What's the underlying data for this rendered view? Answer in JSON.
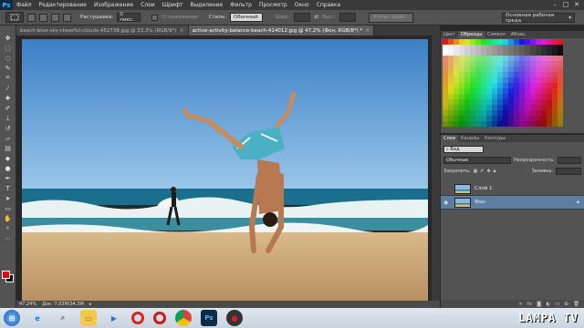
{
  "app": {
    "logo": "Ps",
    "menu": [
      "Файл",
      "Редактирование",
      "Изображение",
      "Слои",
      "Шрифт",
      "Выделение",
      "Фильтр",
      "Просмотр",
      "Окно",
      "Справка"
    ],
    "window_controls": [
      "–",
      "□",
      "✕"
    ]
  },
  "options": {
    "feather_label": "Растушевка:",
    "feather_value": "0 пикс.",
    "antialias_label": "Сглаживание",
    "style_label": "Стиль:",
    "style_value": "Обычный",
    "width_label": "Шир.:",
    "height_label": "Выс.:",
    "refine_edge": "Уточн. край...",
    "workspace": "Основная рабочая среда"
  },
  "documents": [
    {
      "title": "beach-blue-sky-cheerful-clouds-452738.jpg @ 33,3% (RGB/8*)"
    },
    {
      "title": "active-activity-balance-beach-414012.jpg @ 47,2% (Фон, RGB/8*) *"
    }
  ],
  "status": {
    "zoom": "47,24%",
    "doc_size": "Док: 7,03M/34,3M"
  },
  "swatch_panel": {
    "tabs": [
      "Цвет",
      "Образцы",
      "Символ",
      "Абзац"
    ],
    "active_tab": 1
  },
  "layers_panel": {
    "tabs": [
      "Слои",
      "Каналы",
      "Контуры"
    ],
    "active_tab": 0,
    "kind_label": "Вид",
    "blend_mode": "Обычные",
    "opacity_label": "Непрозрачность:",
    "lock_label": "Закрепить:",
    "fill_label": "Заливка:",
    "layers": [
      {
        "name": "Слой 1",
        "visible": false,
        "selected": false
      },
      {
        "name": "Фон",
        "visible": true,
        "selected": true
      }
    ]
  },
  "colors": {
    "foreground": "#e8000c",
    "background": "#000000"
  },
  "taskbar": {
    "watermark": "LAMPA TV"
  }
}
